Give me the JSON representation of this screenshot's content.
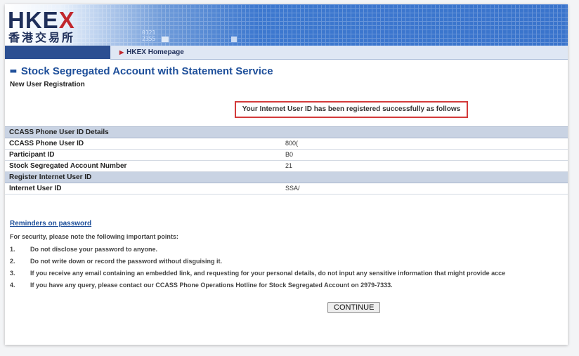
{
  "header": {
    "logo_text": "HKE",
    "logo_x": "X",
    "logo_chinese": "香港交易所",
    "ticker_top": "0121",
    "ticker_bottom": "2355"
  },
  "nav": {
    "homepage_link": "HKEX Homepage"
  },
  "page": {
    "title": "Stock Segregated Account with Statement Service",
    "subtitle": "New User Registration",
    "success_message": "Your Internet User ID has been registered successfully as follows"
  },
  "details": {
    "section1_title": "CCASS Phone User ID Details",
    "rows1": [
      {
        "label": "CCASS Phone User ID",
        "value": "800("
      },
      {
        "label": "Participant ID",
        "value": "B0"
      },
      {
        "label": "Stock Segregated Account Number",
        "value": "21"
      }
    ],
    "section2_title": "Register Internet User ID",
    "rows2": [
      {
        "label": "Internet User ID",
        "value": "SSA/"
      }
    ]
  },
  "reminders": {
    "link_text": "Reminders on password",
    "intro": "For security, please note the following important points:",
    "points": [
      {
        "num": "1.",
        "text": "Do not disclose your password to anyone."
      },
      {
        "num": "2.",
        "text": "Do not write down or record the password without disguising it."
      },
      {
        "num": "3.",
        "text": "If you receive any email containing an embedded link, and requesting for your personal details, do not input any sensitive information that might provide acce"
      },
      {
        "num": "4.",
        "text": "If you have any query, please contact our CCASS Phone Operations Hotline for Stock Segregated Account on 2979-7333."
      }
    ]
  },
  "actions": {
    "continue_label": "CONTINUE"
  },
  "colors": {
    "brand_blue": "#1e4f9a",
    "brand_red": "#c1272d",
    "success_border": "#d33a3a",
    "section_header_bg": "#c9d3e3"
  }
}
